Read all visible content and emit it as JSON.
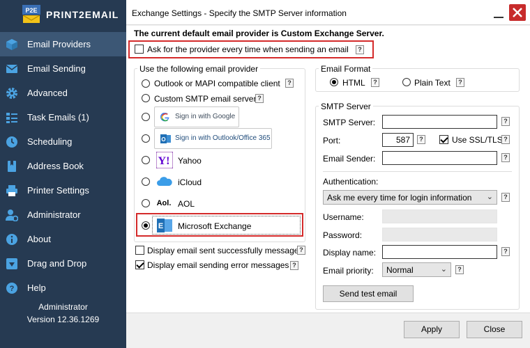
{
  "app": {
    "brand_name": "PRINT2EMAIL",
    "logo_text": "P2E",
    "user": "Administrator",
    "version": "Version 12.36.1269"
  },
  "sidebar": {
    "items": [
      {
        "label": "Email Providers",
        "icon": "box-icon",
        "active": true
      },
      {
        "label": "Email Sending",
        "icon": "envelope-icon"
      },
      {
        "label": "Advanced",
        "icon": "gear-icon"
      },
      {
        "label": "Task Emails (1)",
        "icon": "tasks-icon"
      },
      {
        "label": "Scheduling",
        "icon": "clock-icon"
      },
      {
        "label": "Address Book",
        "icon": "book-icon"
      },
      {
        "label": "Printer Settings",
        "icon": "printer-icon"
      },
      {
        "label": "Administrator",
        "icon": "user-gear-icon"
      },
      {
        "label": "About",
        "icon": "info-icon"
      },
      {
        "label": "Drag and Drop",
        "icon": "download-icon"
      },
      {
        "label": "Help",
        "icon": "question-icon"
      }
    ]
  },
  "window": {
    "title": "Exchange Settings - Specify the SMTP Server information"
  },
  "main": {
    "default_provider_text": "The current default email provider is Custom Exchange Server.",
    "ask_provider_label": "Ask for the provider every time when sending an email",
    "provider_group_title": "Use the following email provider",
    "providers": {
      "outlook_mapi": "Outlook or MAPI compatible client",
      "custom_smtp": "Custom SMTP email server",
      "google": "Sign in with Google",
      "outlook365": "Sign in with Outlook/Office 365",
      "yahoo": "Yahoo",
      "icloud": "iCloud",
      "aol": "AOL",
      "aol_logo": "Aol.",
      "exchange": "Microsoft Exchange"
    },
    "display_success_label": "Display email sent successfully message",
    "display_error_label": "Display email sending error messages",
    "email_format": {
      "title": "Email Format",
      "html": "HTML",
      "plain": "Plain Text"
    },
    "smtp": {
      "title": "SMTP Server",
      "server_label": "SMTP Server:",
      "server_value": "",
      "port_label": "Port:",
      "port_value": "587",
      "ssl_label": "Use SSL/TLS",
      "sender_label": "Email Sender:",
      "sender_value": "",
      "auth_label": "Authentication:",
      "auth_value": "Ask me every time for login information",
      "username_label": "Username:",
      "password_label": "Password:",
      "display_name_label": "Display name:",
      "display_name_value": "",
      "priority_label": "Email priority:",
      "priority_value": "Normal",
      "send_test": "Send test email"
    },
    "help_glyph": "?"
  },
  "footer": {
    "apply": "Apply",
    "close": "Close"
  },
  "colors": {
    "sidebar_bg": "#263a52",
    "sidebar_active": "#3c5775",
    "highlight_red": "#d42a2a",
    "close_red": "#c72b2b"
  }
}
